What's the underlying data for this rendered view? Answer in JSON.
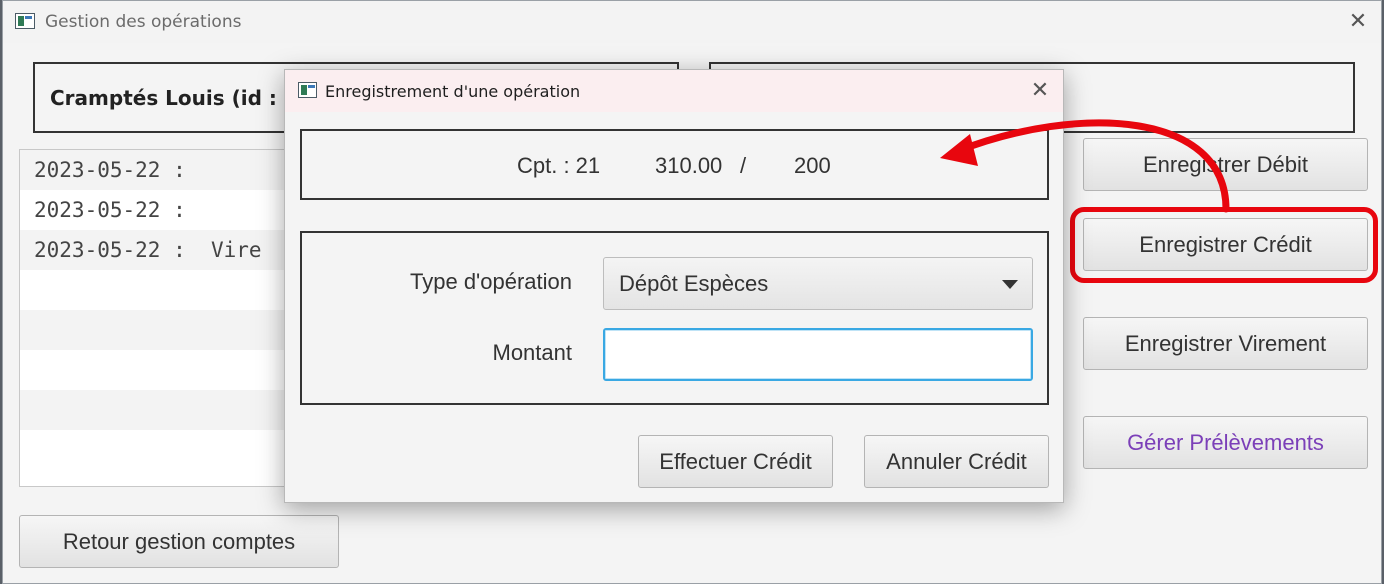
{
  "window": {
    "title": "Gestion des opérations",
    "close_glyph": "✕"
  },
  "client": {
    "label": "Cramptés  Louis  (id :"
  },
  "operations": [
    {
      "text": "2023-05-22 :"
    },
    {
      "text": "2023-05-22 :"
    },
    {
      "text": "2023-05-22 :  Vire"
    }
  ],
  "buttons": {
    "debit": "Enregistrer Débit",
    "credit": "Enregistrer Crédit",
    "virement": "Enregistrer Virement",
    "prelevements": "Gérer Prélèvements",
    "retour": "Retour gestion comptes"
  },
  "dialog": {
    "title": "Enregistrement d'une opération",
    "close_glyph": "✕",
    "account_label": "Cpt. : 21",
    "balance": "310.00",
    "separator": "/",
    "overdraft": "200",
    "type_label": "Type d'opération",
    "type_value": "Dépôt Espèces",
    "amount_label": "Montant",
    "amount_value": "",
    "submit": "Effectuer Crédit",
    "cancel": "Annuler Crédit"
  },
  "colors": {
    "highlight": "#e8060e",
    "focus": "#39a8e3",
    "link_purple": "#7b3fb8"
  },
  "icons": [
    "app-icon",
    "close-icon",
    "dropdown-arrow-icon",
    "annotation-arrow"
  ]
}
